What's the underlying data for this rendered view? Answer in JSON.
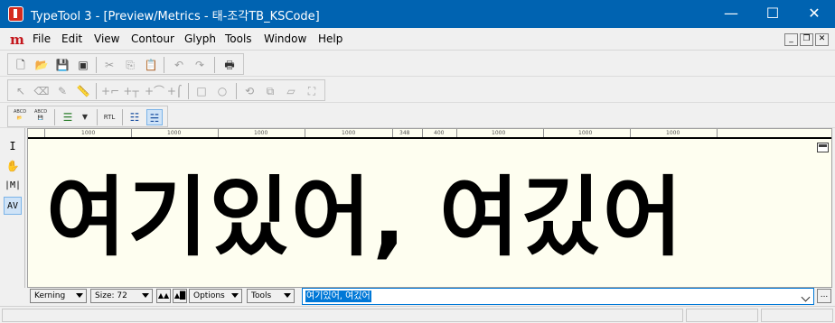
{
  "window": {
    "title": "TypeTool 3 - [Preview/Metrics - 태-조각TB_KSCode]",
    "minimize": "—",
    "maximize": "☐",
    "close": "✕"
  },
  "menu": {
    "logo": "m",
    "items": [
      {
        "label": "File"
      },
      {
        "label": "Edit"
      },
      {
        "label": "View"
      },
      {
        "label": "Contour"
      },
      {
        "label": "Glyph"
      },
      {
        "label": "Tools"
      },
      {
        "label": "Window"
      },
      {
        "label": "Help"
      }
    ],
    "mdi": {
      "minimize": "_",
      "restore": "❐",
      "close": "✕"
    }
  },
  "toolbar1": {
    "icons": [
      "new-file-icon",
      "open-folder-icon",
      "save-icon",
      "save-all-icon",
      "cut-icon",
      "copy-icon",
      "paste-icon",
      "undo-icon",
      "redo-icon",
      "print-icon"
    ]
  },
  "toolbar2": {
    "icons": [
      "pointer-icon",
      "eraser-icon",
      "pen-icon",
      "ruler-icon",
      "add-corner-icon",
      "add-tangent-icon",
      "add-curve-icon",
      "add-point-icon",
      "rectangle-icon",
      "ellipse-icon",
      "rotate-icon",
      "scale-icon",
      "slant-icon",
      "transform-icon"
    ]
  },
  "toolbar3": {
    "abcd_label_1": "ABCD",
    "abcd_label_2": "ABCD",
    "rtl_label": "RTL",
    "icons": [
      "open-string-icon",
      "save-string-icon",
      "list-icon",
      "rtl-icon",
      "metrics-mode-icon",
      "kerning-mode-icon"
    ]
  },
  "tools_left": [
    {
      "name": "text-tool-icon",
      "glyph": "I"
    },
    {
      "name": "hand-tool-icon",
      "glyph": "✋"
    },
    {
      "name": "metrics-tool-icon",
      "glyph": "|M|"
    },
    {
      "name": "kerning-tool-icon",
      "glyph": "AV"
    }
  ],
  "ruler": {
    "labels": [
      "1000",
      "1000",
      "1000",
      "1000",
      "348",
      "400",
      "1000",
      "1000",
      "1000"
    ]
  },
  "preview": {
    "text": "여기있어, 여깄어"
  },
  "bottom": {
    "kerning_label": "Kerning",
    "size_label": "Size: 72",
    "options_label": "Options",
    "tools_label": "Tools",
    "text_value": "여기있어, 여깄어",
    "ellipsis": "..."
  },
  "colors": {
    "titlebar": "#0063b1",
    "preview_bg": "#fefef0",
    "selection": "#0078d7",
    "logo": "#c4161c"
  }
}
